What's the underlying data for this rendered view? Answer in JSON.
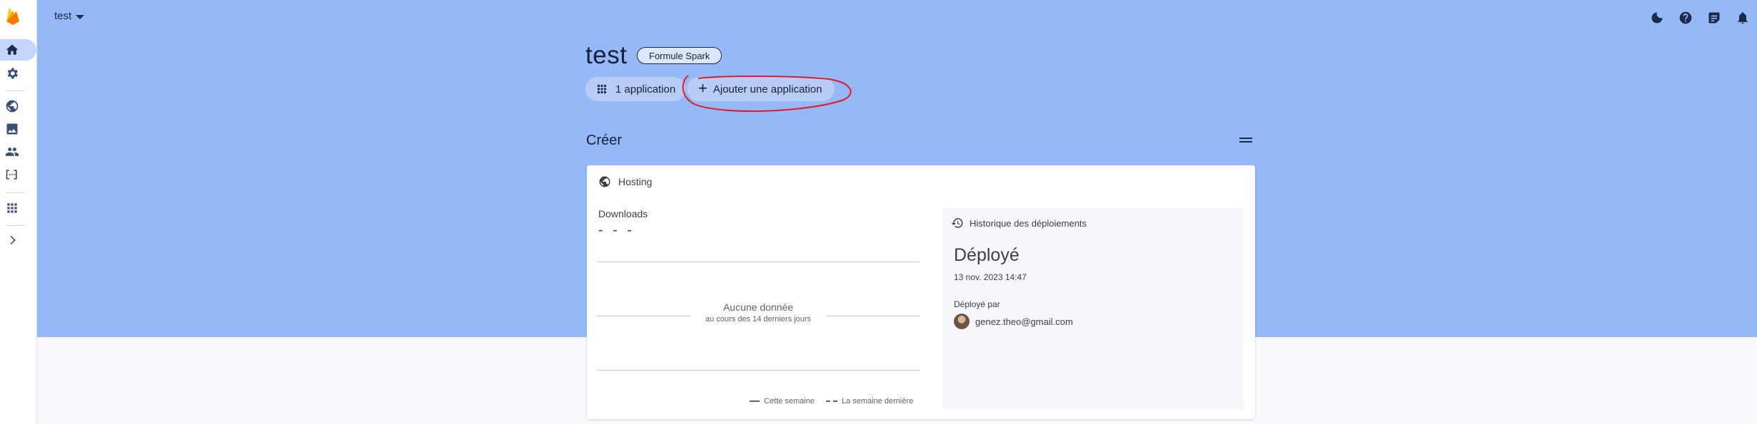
{
  "project": {
    "name": "test",
    "plan_badge": "Formule Spark"
  },
  "header": {
    "project_selector": "test"
  },
  "apps": {
    "count_label": "1 application",
    "add_label": "Ajouter une application"
  },
  "section": {
    "title": "Créer"
  },
  "hosting_card": {
    "title": "Hosting",
    "metric_label": "Downloads",
    "metric_value": "- - -",
    "empty_main": "Aucune donnée",
    "empty_sub": "au cours des 14 derniers jours",
    "legend_this_week": "Cette semaine",
    "legend_last_week": "La semaine dernière",
    "history": {
      "title": "Historique des déploiements",
      "status": "Déployé",
      "date": "13 nov. 2023 14:47",
      "by_label": "Déployé par",
      "user": "genez.theo@gmail.com"
    }
  },
  "colors": {
    "hero_bg": "#95b8f6",
    "annotation": "#e01b24",
    "logo": "#ffa000"
  }
}
